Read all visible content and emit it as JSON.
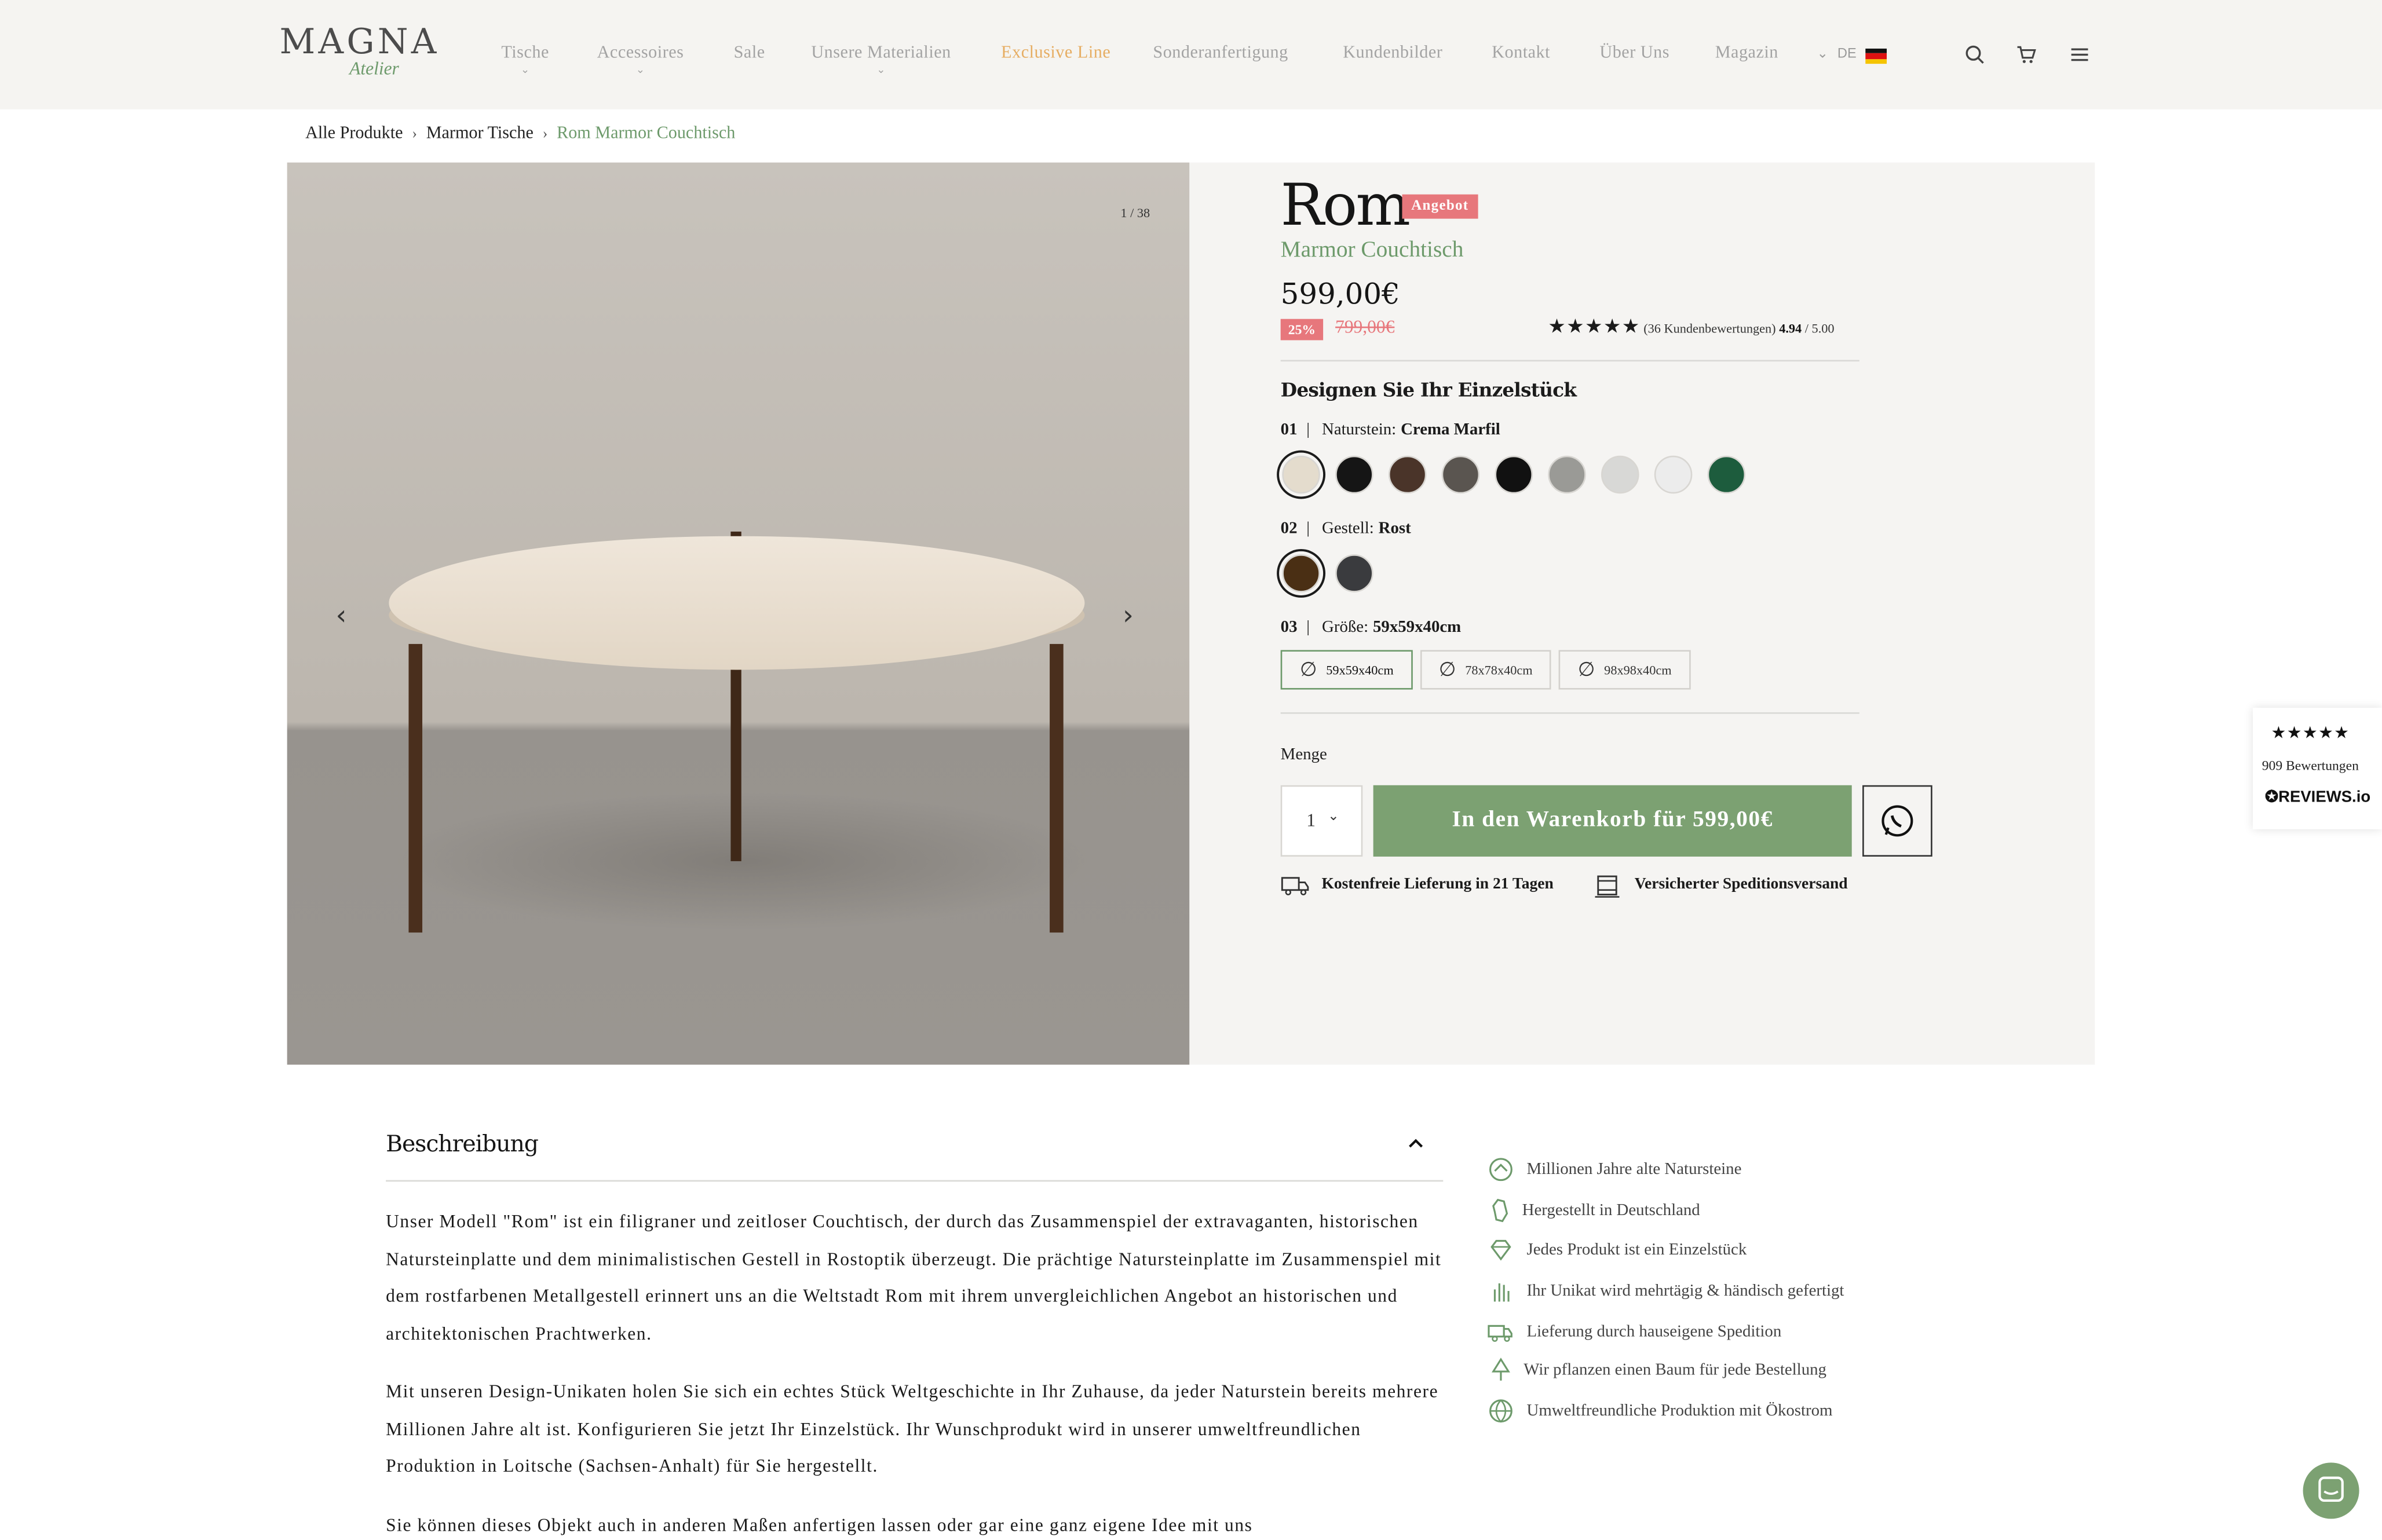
{
  "brand": {
    "name": "MAGNA",
    "sub": "Atelier"
  },
  "nav": {
    "items": [
      {
        "label": "Tische",
        "has_dropdown": true
      },
      {
        "label": "Accessoires",
        "has_dropdown": true
      },
      {
        "label": "Sale",
        "has_dropdown": false
      },
      {
        "label": "Unsere Materialien",
        "has_dropdown": true
      },
      {
        "label": "Exclusive Line",
        "has_dropdown": false,
        "highlight_color": "#e6ad62"
      },
      {
        "label": "Sonderanfertigung",
        "has_dropdown": false
      },
      {
        "label": "Kundenbilder",
        "has_dropdown": false
      },
      {
        "label": "Kontakt",
        "has_dropdown": false
      },
      {
        "label": "Über Uns",
        "has_dropdown": false
      },
      {
        "label": "Magazin",
        "has_dropdown": false
      }
    ],
    "language": "DE",
    "icons": [
      "search-icon",
      "cart-icon",
      "menu-icon"
    ]
  },
  "breadcrumb": [
    "Alle Produkte",
    "Marmor Tische",
    "Rom Marmor Couchtisch"
  ],
  "gallery": {
    "counter": "1 / 38"
  },
  "product": {
    "title": "Rom",
    "badge": "Angebot",
    "subtitle": "Marmor Couchtisch",
    "price": "599,00€",
    "discount": "25%",
    "old_price": "799,00€",
    "rating": {
      "stars": "★★★★★",
      "count_text": "(36 Kundenbewertungen)",
      "score": "4.94",
      "max": "/ 5.00"
    },
    "design_title": "Designen Sie Ihr Einzelstück",
    "options": [
      {
        "num": "01",
        "label": "Naturstein:",
        "value": "Crema Marfil"
      },
      {
        "num": "02",
        "label": "Gestell:",
        "value": "Rost"
      },
      {
        "num": "03",
        "label": "Größe:",
        "value": "59x59x40cm"
      }
    ],
    "stone_swatches": [
      "#e4dccd",
      "#151515",
      "#4a3429",
      "#5a5550",
      "#111111",
      "#9a9a96",
      "#d8d8d6",
      "#ececec",
      "#1d5c3d"
    ],
    "frame_swatches": [
      "#4a2f14",
      "#3a3b3e"
    ],
    "sizes": [
      "59x59x40cm",
      "78x78x40cm",
      "98x98x40cm"
    ],
    "quantity_label": "Menge",
    "quantity": "1",
    "cart_button": "In den Warenkorb für 599,00€",
    "usps": [
      "Kostenfreie Lieferung in 21 Tagen",
      "Versicherter Speditionsversand"
    ]
  },
  "reviews_widget": {
    "stars": "★★★★★",
    "count": "909 Bewertungen",
    "brand": "✪REVIEWS.io"
  },
  "description": {
    "heading": "Beschreibung",
    "paragraphs": [
      "Unser Modell \"Rom\" ist ein filigraner und zeitloser Couchtisch, der durch das Zusammenspiel der extravaganten, historischen Natursteinplatte und dem minimalistischen Gestell in Rostoptik überzeugt. Die prächtige Natursteinplatte im Zusammenspiel mit dem rostfarbenen Metallgestell erinnert uns an die Weltstadt Rom mit ihrem unvergleichlichen Angebot an historischen und architektonischen Prachtwerken.",
      "Mit unseren Design-Unikaten holen Sie sich ein echtes Stück Weltgeschichte in Ihr Zuhause, da jeder Naturstein bereits mehrere Millionen Jahre alt ist. Konfigurieren Sie jetzt Ihr Einzelstück. Ihr Wunschprodukt wird in unserer umweltfreundlichen Produktion in Loitsche (Sachsen-Anhalt) für Sie hergestellt.",
      "Sie können dieses Objekt auch in anderen Maßen anfertigen lassen oder gar eine ganz eigene Idee mit uns"
    ]
  },
  "features": [
    "Millionen Jahre alte Natursteine",
    "Hergestellt in Deutschland",
    "Jedes Produkt ist ein Einzelstück",
    "Ihr Unikat wird mehrtägig & händisch gefertigt",
    "Lieferung durch hauseigene Spedition",
    "Wir pflanzen einen Baum für jede Bestellung",
    "Umweltfreundliche Produktion mit Ökostrom"
  ],
  "colors": {
    "accent_green": "#7ca172",
    "sale_red": "#e7777c",
    "panel_bg": "#f5f4f2"
  }
}
